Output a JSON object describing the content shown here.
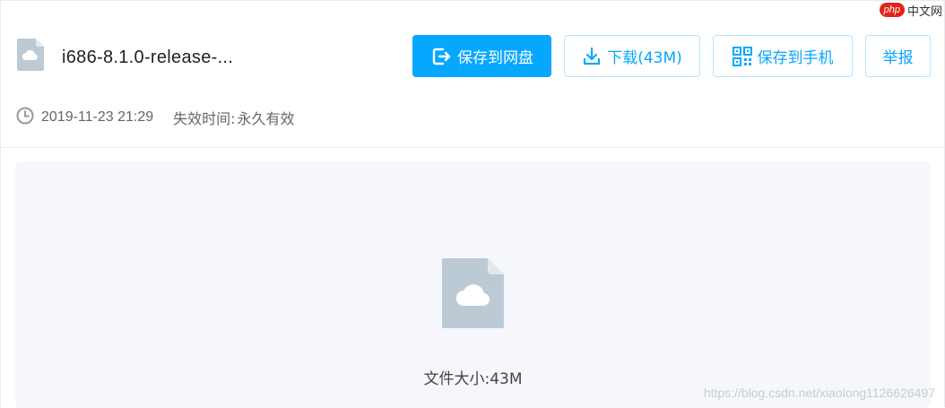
{
  "watermark_top": {
    "php": "php",
    "text": "中文网"
  },
  "file": {
    "name": "i686-8.1.0-release-..."
  },
  "toolbar": {
    "save_to_disk": "保存到网盘",
    "download": "下载(43M)",
    "save_to_phone": "保存到手机",
    "report": "举报"
  },
  "meta": {
    "date": "2019-11-23 21:29",
    "expire_label": "失效时间:",
    "expire_value": "永久有效"
  },
  "preview": {
    "size_text": "文件大小:43M"
  },
  "watermark_bottom": "https://blog.csdn.net/xiaolong1126626497",
  "colors": {
    "accent": "#06a7ff",
    "icon": "#bccad6",
    "panel": "#f5f7fc"
  }
}
